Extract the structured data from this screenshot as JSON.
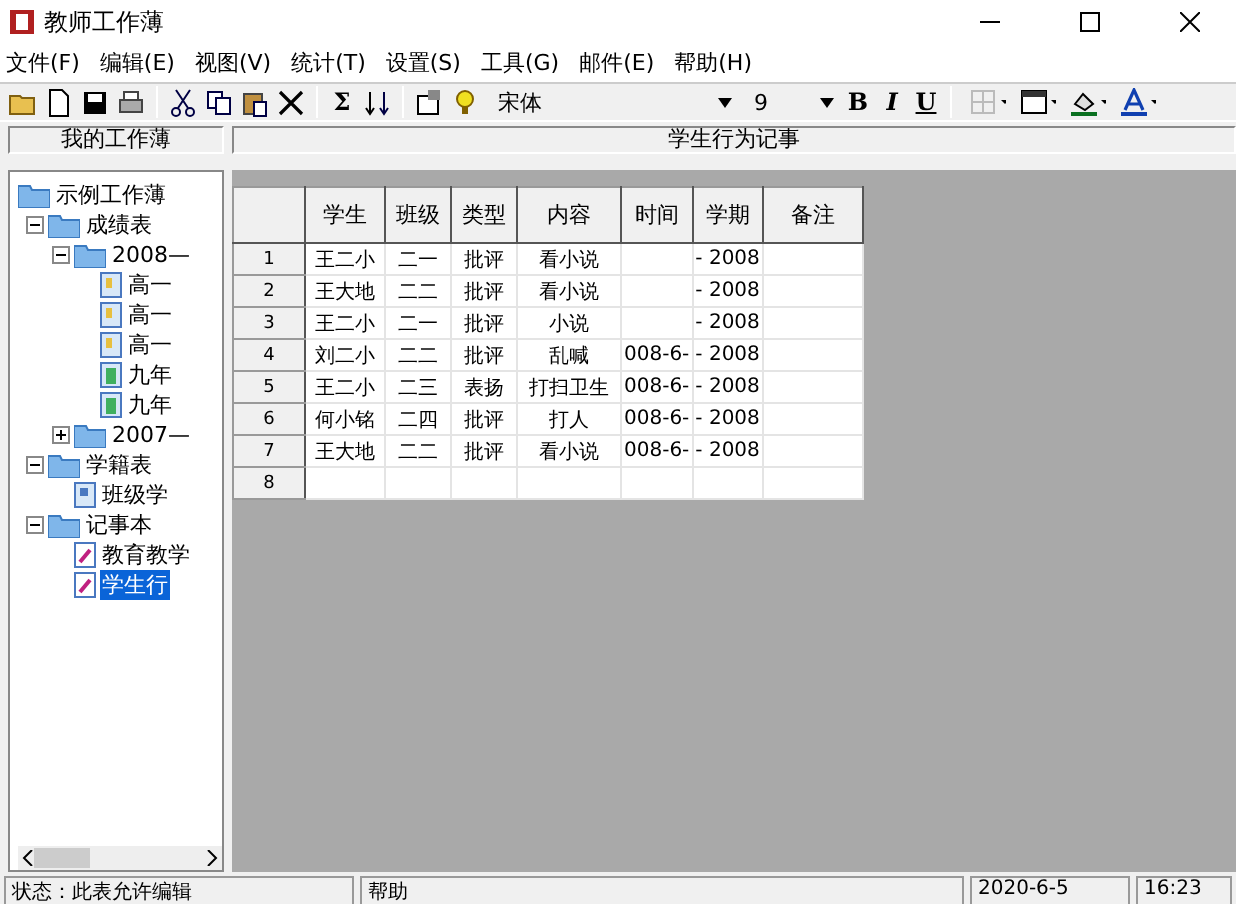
{
  "window": {
    "title": "教师工作薄"
  },
  "menu": [
    "文件(F)",
    "编辑(E)",
    "视图(V)",
    "统计(T)",
    "设置(S)",
    "工具(G)",
    "邮件(E)",
    "帮助(H)"
  ],
  "toolbar": {
    "font": "宋体",
    "size": "9",
    "format_buttons": [
      {
        "label": "B",
        "kind": "bold"
      },
      {
        "label": "I",
        "kind": "italic"
      },
      {
        "label": "U",
        "kind": "underline"
      }
    ],
    "sum_label": "Σ"
  },
  "left_pane": {
    "title": "我的工作薄",
    "tree": [
      {
        "label": "示例工作薄",
        "kind": "folder",
        "selected": false,
        "children": [
          {
            "label": "成绩表",
            "kind": "folder",
            "expanded": true,
            "selected": false,
            "children": [
              {
                "label": "2008—",
                "kind": "folder",
                "expanded": true,
                "selected": false,
                "children": [
                  {
                    "label": "高一",
                    "kind": "sheet",
                    "selected": false
                  },
                  {
                    "label": "高一",
                    "kind": "sheet",
                    "selected": false
                  },
                  {
                    "label": "高一",
                    "kind": "sheet",
                    "selected": false
                  },
                  {
                    "label": "九年",
                    "kind": "chart",
                    "selected": false
                  },
                  {
                    "label": "九年",
                    "kind": "chart",
                    "selected": false
                  }
                ]
              },
              {
                "label": "2007—",
                "kind": "folder",
                "expanded": false,
                "selected": false
              }
            ]
          },
          {
            "label": "学籍表",
            "kind": "folder",
            "expanded": true,
            "selected": false,
            "children": [
              {
                "label": "班级学",
                "kind": "form",
                "selected": false
              }
            ]
          },
          {
            "label": "记事本",
            "kind": "folder",
            "expanded": true,
            "selected": false,
            "children": [
              {
                "label": "教育教学",
                "kind": "note",
                "selected": false
              },
              {
                "label": "学生行",
                "kind": "note",
                "selected": true
              }
            ]
          }
        ]
      }
    ]
  },
  "right_pane": {
    "title": "学生行为记事",
    "table": {
      "columns": [
        "学生",
        "班级",
        "类型",
        "内容",
        "时间",
        "学期",
        "备注"
      ],
      "rows": [
        {
          "number": "1",
          "cells": [
            "王二小",
            "二一",
            "批评",
            "看小说",
            "",
            "- 2008",
            ""
          ]
        },
        {
          "number": "2",
          "cells": [
            "王大地",
            "二二",
            "批评",
            "看小说",
            "",
            "- 2008",
            ""
          ]
        },
        {
          "number": "3",
          "cells": [
            "王二小",
            "二一",
            "批评",
            "小说",
            "",
            "- 2008",
            ""
          ]
        },
        {
          "number": "4",
          "cells": [
            "刘二小",
            "二二",
            "批评",
            "乱喊",
            "008-6-",
            "- 2008",
            ""
          ]
        },
        {
          "number": "5",
          "cells": [
            "王二小",
            "二三",
            "表扬",
            "打扫卫生",
            "008-6-",
            "- 2008",
            ""
          ]
        },
        {
          "number": "6",
          "cells": [
            "何小铭",
            "二四",
            "批评",
            "打人",
            "008-6-",
            "- 2008",
            ""
          ]
        },
        {
          "number": "7",
          "cells": [
            "王大地",
            "二二",
            "批评",
            "看小说",
            "008-6-",
            "- 2008",
            ""
          ]
        },
        {
          "number": "8",
          "cells": [
            "",
            "",
            "",
            "",
            "",
            "",
            ""
          ]
        }
      ]
    }
  },
  "status_bar": {
    "status": "状态：此表允许编辑",
    "help": "帮助",
    "date": "2020-6-5",
    "time": "16:23"
  }
}
